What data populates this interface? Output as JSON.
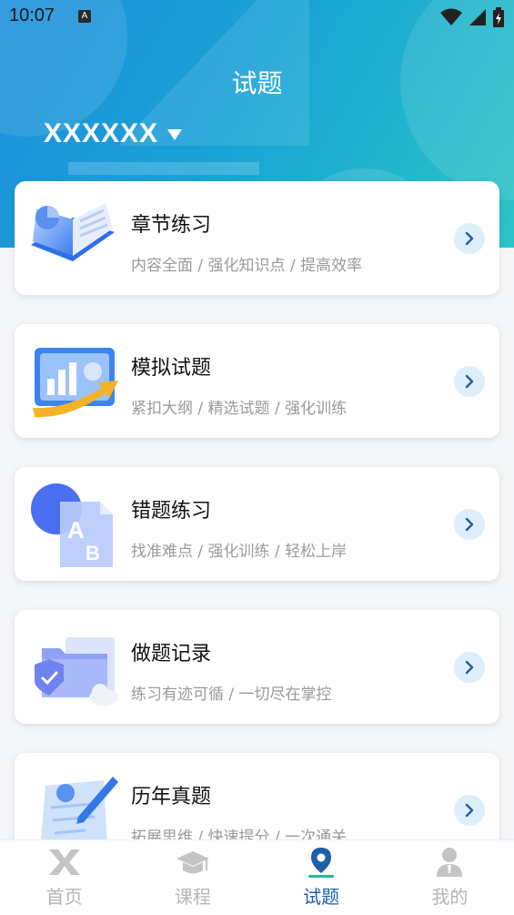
{
  "status_bar": {
    "time": "10:07",
    "badge": "A"
  },
  "header": {
    "title": "试题",
    "selector_label": "XXXXXX"
  },
  "cards": [
    {
      "title": "章节练习",
      "subtitle": "内容全面 / 强化知识点 / 提高效率",
      "icon": "open-book-icon"
    },
    {
      "title": "模拟试题",
      "subtitle": "紧扣大纲 / 精选试题 / 强化训练",
      "icon": "chart-board-icon"
    },
    {
      "title": "错题练习",
      "subtitle": "找准难点 / 强化训练 / 轻松上岸",
      "icon": "ab-document-icon"
    },
    {
      "title": "做题记录",
      "subtitle": "练习有迹可循 / 一切尽在掌控",
      "icon": "folder-shield-icon"
    },
    {
      "title": "历年真题",
      "subtitle": "拓展思维 / 快速提分 / 一次通关",
      "icon": "paper-pen-icon"
    }
  ],
  "tabs": [
    {
      "label": "首页",
      "icon": "home-logo-icon",
      "active": false
    },
    {
      "label": "课程",
      "icon": "graduation-cap-icon",
      "active": false
    },
    {
      "label": "试题",
      "icon": "location-pin-icon",
      "active": true
    },
    {
      "label": "我的",
      "icon": "user-icon",
      "active": false
    }
  ],
  "colors": {
    "accent": "#1d5fa8",
    "header_start": "#1e8fdc",
    "header_end": "#2dc4c6",
    "arrow_bg": "#deeefb"
  }
}
